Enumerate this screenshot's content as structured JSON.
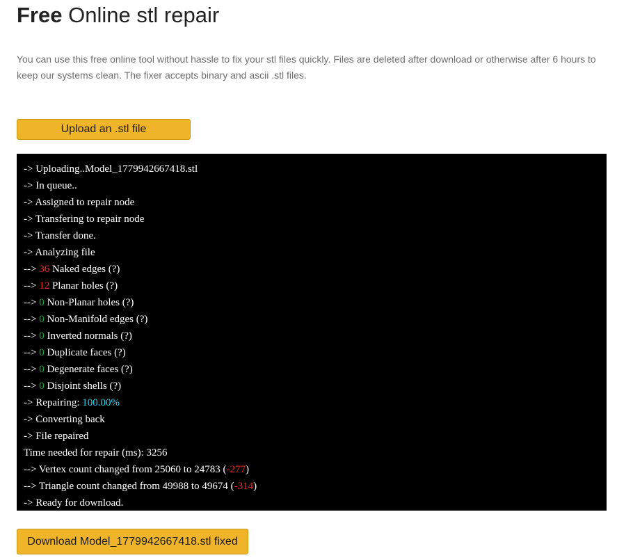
{
  "header": {
    "title_strong": "Free",
    "title_rest": " Online stl repair"
  },
  "intro_text": "You can use this free online tool without hassle to fix your stl files quickly. Files are deleted after download or otherwise after 6 hours to keep our systems clean. The fixer accepts binary and ascii .stl files.",
  "upload_button_label": "Upload an .stl file",
  "log": {
    "uploading": "-> Uploading..Model_1779942667418.stl",
    "in_queue": "-> In queue..",
    "assigned": "-> Assigned to repair node",
    "transfering": "-> Transfering to repair node",
    "transfer_done": "-> Transfer done.",
    "analyzing": "-> Analyzing file",
    "checks": [
      {
        "prefix": "--> ",
        "count": "36",
        "label": " Naked edges  (?)",
        "status": "bad"
      },
      {
        "prefix": "--> ",
        "count": "12",
        "label": " Planar holes  (?)",
        "status": "bad"
      },
      {
        "prefix": "--> ",
        "count": "0",
        "label": " Non-Planar holes  (?)",
        "status": "good"
      },
      {
        "prefix": "--> ",
        "count": "0",
        "label": " Non-Manifold edges  (?)",
        "status": "good"
      },
      {
        "prefix": "--> ",
        "count": "0",
        "label": " Inverted normals  (?)",
        "status": "good"
      },
      {
        "prefix": "--> ",
        "count": "0",
        "label": " Duplicate faces  (?)",
        "status": "good"
      },
      {
        "prefix": "--> ",
        "count": "0",
        "label": " Degenerate faces  (?)",
        "status": "good"
      },
      {
        "prefix": "--> ",
        "count": "0",
        "label": " Disjoint shells  (?)",
        "status": "good"
      }
    ],
    "repairing_label": "-> Repairing: ",
    "repairing_value": "100.00%",
    "converting": "-> Converting back",
    "file_repaired": "-> File repaired",
    "time_needed": "Time needed for repair (ms): 3256",
    "vertex": {
      "text": "--> Vertex count changed from 25060 to 24783 (",
      "delta": "-277",
      "close": ")"
    },
    "triangle": {
      "text": "--> Triangle count changed from 49988 to 49674 (",
      "delta": "-314",
      "close": ")"
    },
    "ready": "-> Ready for download."
  },
  "download_button_label": "Download Model_1779942667418.stl fixed",
  "colors": {
    "button_bg": "#f0b429",
    "console_bg": "#000000",
    "bad_count": "#ff2020",
    "good_count": "#19a83b",
    "progress": "#22d3ee"
  }
}
